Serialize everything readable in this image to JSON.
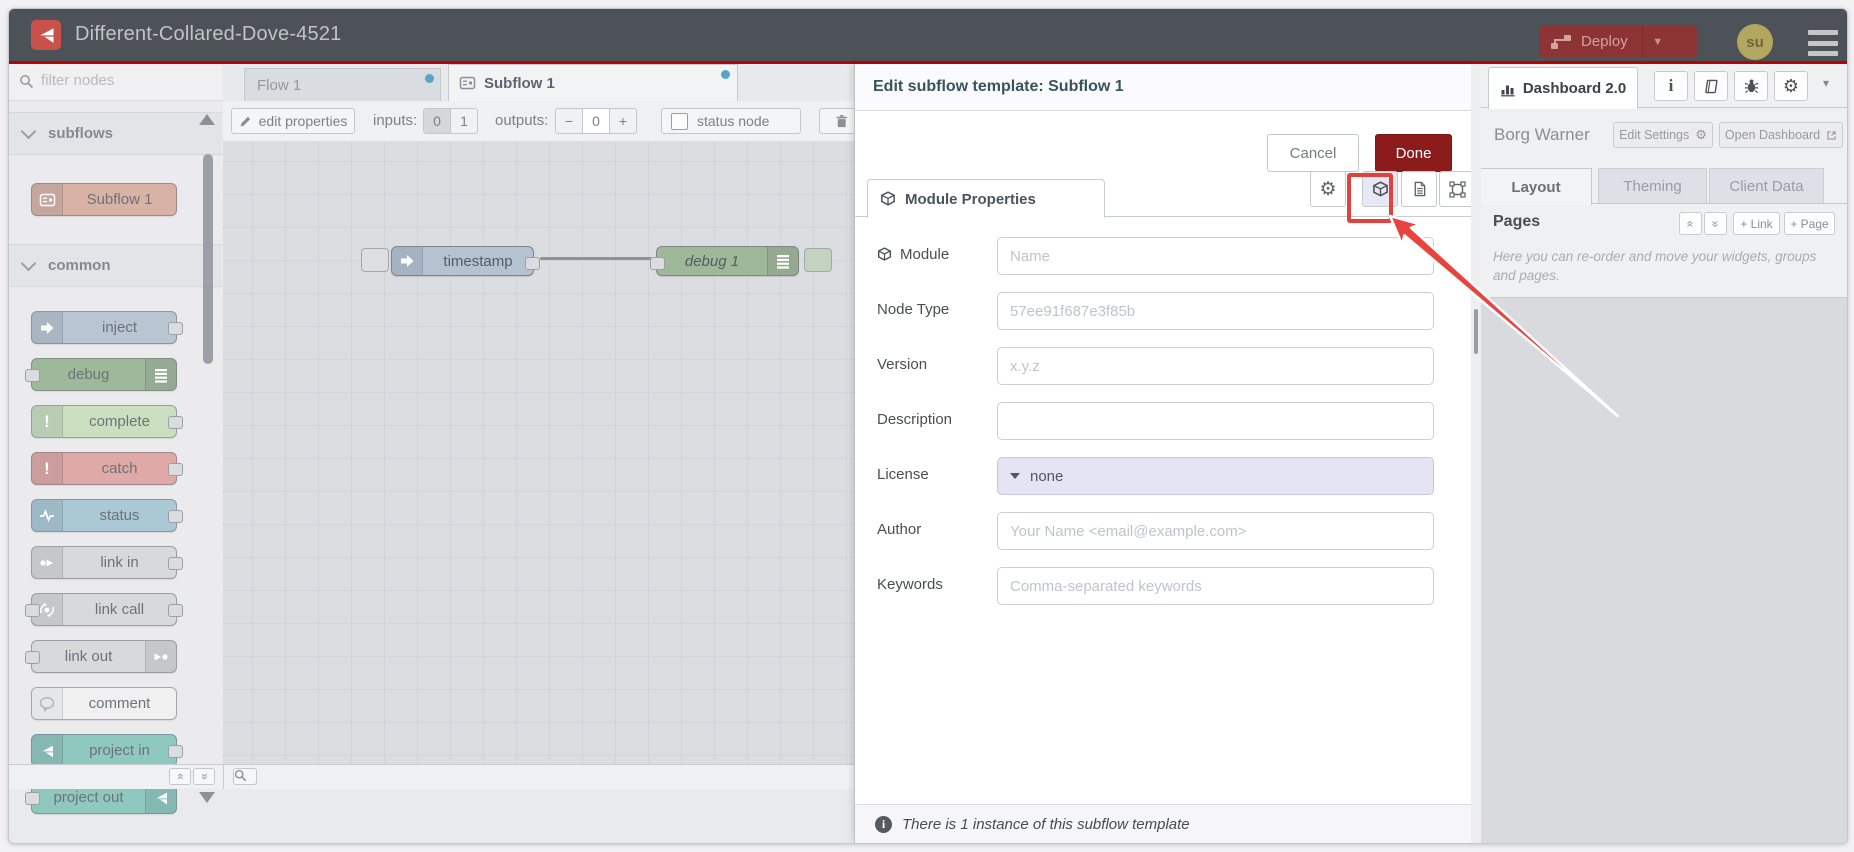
{
  "header": {
    "title": "Different-Collared-Dove-4521",
    "deploy_label": "Deploy",
    "avatar_initials": "su"
  },
  "palette": {
    "search_placeholder": "filter nodes",
    "sections": [
      {
        "label": "subflows",
        "nodes": [
          "Subflow 1"
        ]
      },
      {
        "label": "common",
        "nodes": [
          "inject",
          "debug",
          "complete",
          "catch",
          "status",
          "link in",
          "link call",
          "link out",
          "comment",
          "project in",
          "project out"
        ]
      }
    ]
  },
  "workspace": {
    "tabs": [
      "Flow 1",
      "Subflow 1"
    ],
    "toolbar": {
      "edit_properties": "edit properties",
      "inputs_label": "inputs:",
      "input_options": [
        "0",
        "1"
      ],
      "inputs_selected": "0",
      "outputs_label": "outputs:",
      "outputs_minus": "−",
      "outputs_value": "0",
      "outputs_plus": "+",
      "status_node_label": "status node"
    },
    "nodes": [
      "timestamp",
      "debug 1"
    ]
  },
  "dialog": {
    "title": "Edit subflow template: Subflow 1",
    "cancel_label": "Cancel",
    "done_label": "Done",
    "tab_label": "Module Properties",
    "fields": [
      {
        "label": "Module",
        "placeholder": "Name"
      },
      {
        "label": "Node Type",
        "placeholder": "57ee91f687e3f85b"
      },
      {
        "label": "Version",
        "placeholder": "x.y.z"
      },
      {
        "label": "Description",
        "placeholder": ""
      },
      {
        "label": "License",
        "value": "none"
      },
      {
        "label": "Author",
        "placeholder": "Your Name <email@example.com>"
      },
      {
        "label": "Keywords",
        "placeholder": "Comma-separated keywords"
      }
    ],
    "footer_text": "There is 1 instance of this subflow template"
  },
  "sidebar": {
    "tab_label": "Dashboard 2.0",
    "project_name": "Borg Warner",
    "edit_settings_label": "Edit Settings",
    "open_dashboard_label": "Open Dashboard",
    "tabs": [
      "Layout",
      "Theming",
      "Client Data"
    ],
    "pages_title": "Pages",
    "link_button": "+ Link",
    "page_button": "+ Page",
    "help_text": "Here you can re-order and move your widgets, groups and pages."
  },
  "glyphs": {
    "gear": "⚙",
    "collapse_up": "«",
    "collapse_down": "»",
    "scroll_up": "▲",
    "scroll_down": "▼",
    "scroll_left": "◀",
    "caret_down": "▾"
  },
  "colors": {
    "header_bg": "#4c5257",
    "accent_red_line": "#bb0000",
    "deploy_bg": "#8c3434",
    "done_bg": "#8c1c1c",
    "annotation_red": "#e2423c",
    "tab_dot_blue": "#58a5c4",
    "license_field_bg": "#e4e4f5",
    "node_subflow": "#d8b2a7",
    "node_inject": "#b8c5d3",
    "node_debug": "#a0b89a",
    "node_complete": "#c9dfc0",
    "node_catch": "#dfa9a7",
    "node_status": "#abc9d5",
    "node_link": "#d8d9db",
    "node_comment": "#f0f0f1",
    "node_project": "#8fc8bf"
  }
}
